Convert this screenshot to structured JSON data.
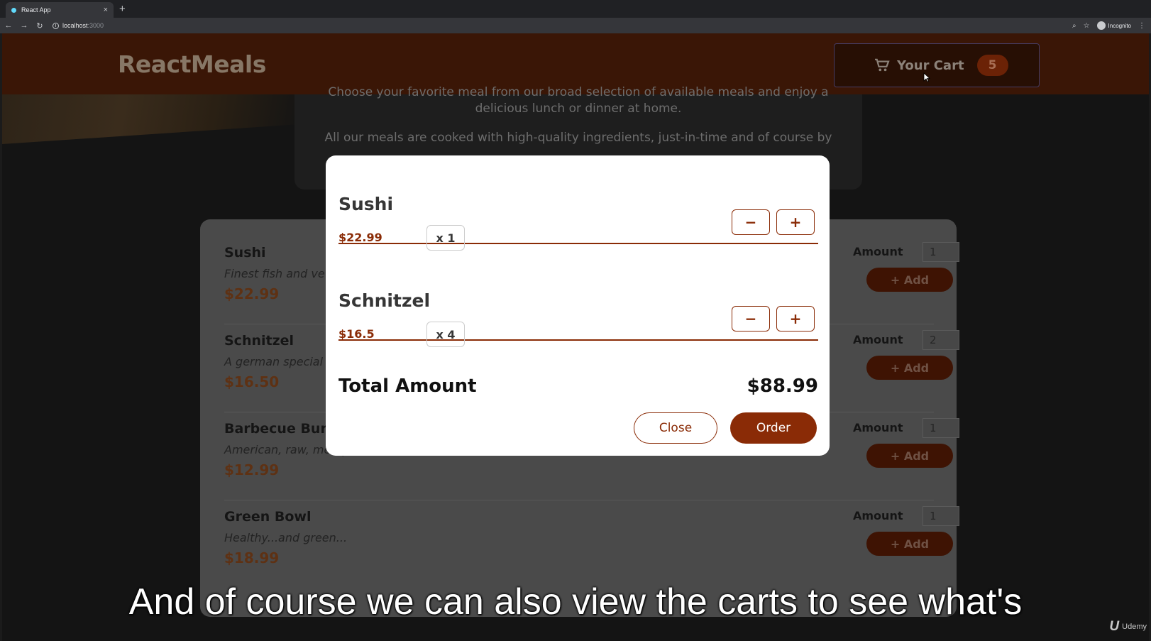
{
  "browser": {
    "tab_title": "React App",
    "tab_close": "×",
    "new_tab": "+",
    "url_host": "localhost",
    "url_port": ":3000",
    "profile": "Incognito"
  },
  "header": {
    "brand": "ReactMeals",
    "cart_label": "Your Cart",
    "cart_count": "5"
  },
  "summary": {
    "line1": "Choose your favorite meal from our broad selection of available meals and enjoy a delicious lunch or dinner at home.",
    "line2": "All our meals are cooked with high-quality ingredients, just-in-time and of course by"
  },
  "meals": [
    {
      "name": "Sushi",
      "description": "Finest fish and ve",
      "price": "$22.99",
      "amount_label": "Amount",
      "amount": "1",
      "add_label": "+ Add"
    },
    {
      "name": "Schnitzel",
      "description": "A german special",
      "price": "$16.50",
      "amount_label": "Amount",
      "amount": "2",
      "add_label": "+ Add"
    },
    {
      "name": "Barbecue Bur",
      "description": "American, raw, meaty",
      "price": "$12.99",
      "amount_label": "Amount",
      "amount": "1",
      "add_label": "+ Add"
    },
    {
      "name": "Green Bowl",
      "description": "Healthy...and green...",
      "price": "$18.99",
      "amount_label": "Amount",
      "amount": "1",
      "add_label": "+ Add"
    }
  ],
  "cart": {
    "items": [
      {
        "name": "Sushi",
        "price": "$22.99",
        "quantity": "x 1",
        "minus": "−",
        "plus": "+"
      },
      {
        "name": "Schnitzel",
        "price": "$16.5",
        "quantity": "x 4",
        "minus": "−",
        "plus": "+"
      }
    ],
    "total_label": "Total Amount",
    "total_value": "$88.99",
    "close_label": "Close",
    "order_label": "Order"
  },
  "subtitle": "And of course we can also view the carts to see what's",
  "watermark": "Udemy",
  "colors": {
    "accent": "#8a2b06",
    "header_dimmed": "#3a1606",
    "modal_bg": "#ffffff"
  },
  "icons": [
    "cart-icon",
    "back-arrow-icon",
    "forward-arrow-icon",
    "reload-icon",
    "zoom-icon",
    "star-icon",
    "more-icon"
  ]
}
